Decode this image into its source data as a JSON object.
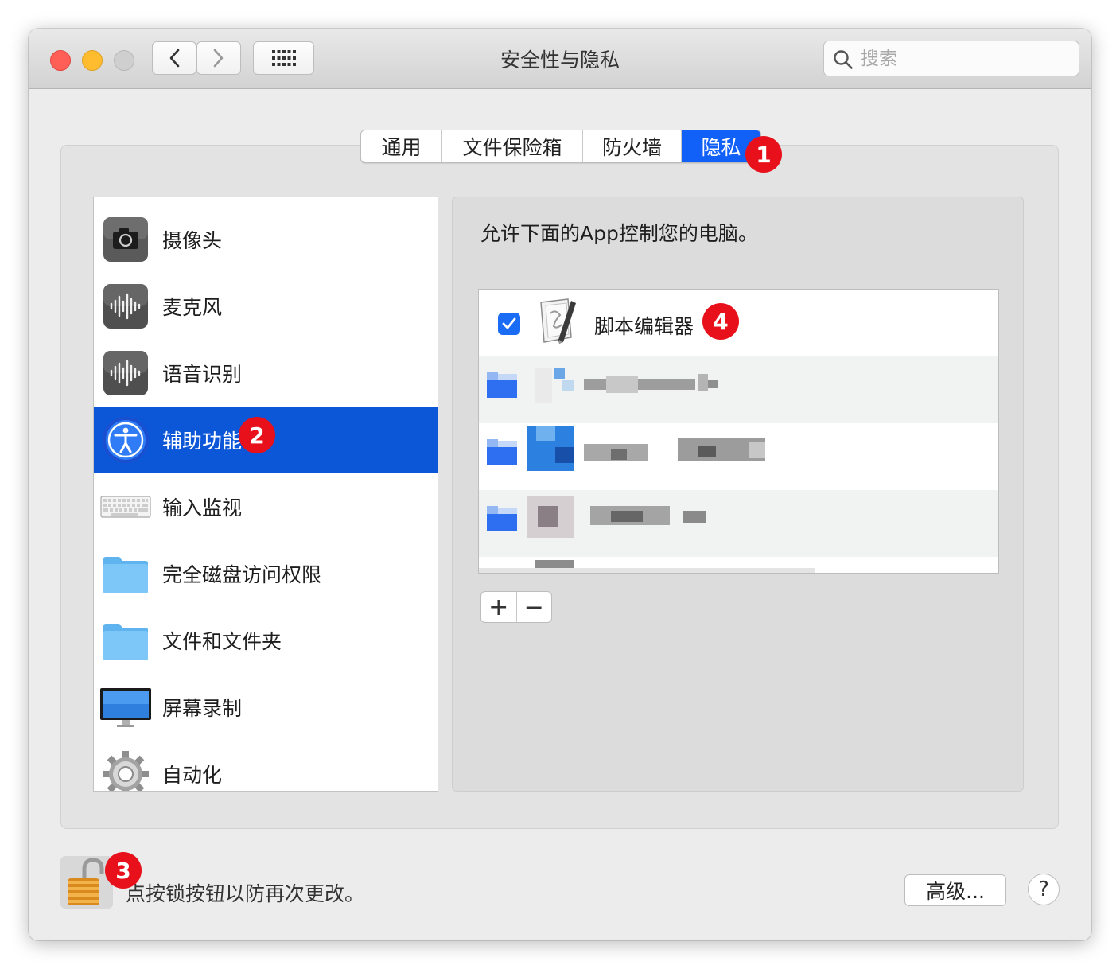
{
  "window": {
    "title": "安全性与隐私"
  },
  "toolbar": {
    "search_placeholder": "搜索"
  },
  "tabs": [
    {
      "label": "通用",
      "active": false
    },
    {
      "label": "文件保险箱",
      "active": false
    },
    {
      "label": "防火墙",
      "active": false
    },
    {
      "label": "隐私",
      "active": true
    }
  ],
  "sidebar": {
    "items": [
      {
        "label": "摄像头",
        "icon": "camera-icon"
      },
      {
        "label": "麦克风",
        "icon": "microphone-icon"
      },
      {
        "label": "语音识别",
        "icon": "speech-recognition-icon"
      },
      {
        "label": "辅助功能",
        "icon": "accessibility-icon",
        "selected": true
      },
      {
        "label": "输入监视",
        "icon": "keyboard-icon"
      },
      {
        "label": "完全磁盘访问权限",
        "icon": "folder-icon"
      },
      {
        "label": "文件和文件夹",
        "icon": "folder-icon"
      },
      {
        "label": "屏幕录制",
        "icon": "display-icon"
      },
      {
        "label": "自动化",
        "icon": "gear-icon"
      }
    ]
  },
  "main": {
    "description": "允许下面的App控制您的电脑。",
    "apps": [
      {
        "name": "脚本编辑器",
        "checked": true,
        "icon": "script-editor-icon"
      }
    ],
    "add_label": "+",
    "remove_label": "−"
  },
  "footer": {
    "lock_text": "点按锁按钮以防再次更改。",
    "advanced_label": "高级...",
    "help_label": "?"
  },
  "badges": [
    "1",
    "2",
    "3",
    "4"
  ],
  "colors": {
    "accent": "#1160f7",
    "selection": "#0c56d8",
    "badge": "#e8101b"
  }
}
